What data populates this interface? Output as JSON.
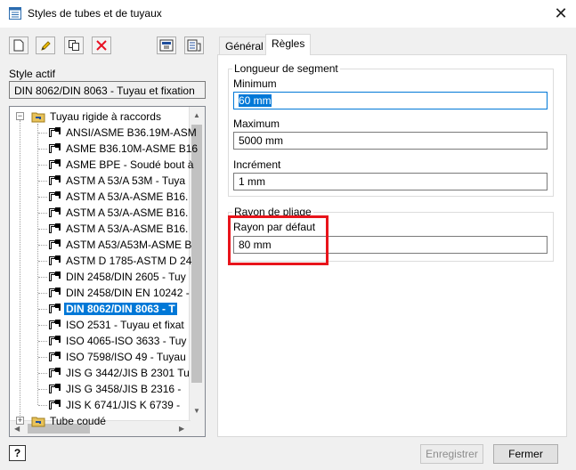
{
  "window": {
    "title": "Styles de tubes et de tuyaux",
    "close_glyph": "✕"
  },
  "toolbar": {
    "items": [
      {
        "name": "new-icon"
      },
      {
        "name": "edit-pencil-icon"
      },
      {
        "name": "copy-icon"
      },
      {
        "name": "delete-icon"
      },
      {
        "name": "import-icon"
      },
      {
        "name": "export-icon"
      }
    ]
  },
  "left": {
    "active_label": "Style actif",
    "active_value": "DIN 8062/DIN 8063 - Tuyau et fixation",
    "tree": {
      "root1": "Tuyau rigide à raccords",
      "items": [
        "ANSI/ASME B36.19M-ASM",
        "ASME B36.10M-ASME B16",
        "ASME BPE - Soudé bout à",
        "ASTM A 53/A 53M - Tuya",
        "ASTM A 53/A-ASME B16.",
        "ASTM A 53/A-ASME B16.",
        "ASTM A 53/A-ASME B16.",
        "ASTM A53/A53M-ASME B",
        "ASTM D 1785-ASTM D 24",
        "DIN 2458/DIN 2605 - Tuy",
        "DIN 2458/DIN EN 10242 -",
        "DIN 8062/DIN 8063 - T",
        "ISO 2531 - Tuyau et fixat",
        "ISO 4065-ISO 3633 - Tuy",
        "ISO 7598/ISO 49 - Tuyau",
        "JIS G 3442/JIS B 2301 Tu",
        "JIS G 3458/JIS B 2316 -",
        "JIS K 6741/JIS K 6739 -"
      ],
      "selected_index": 11,
      "root2": "Tube coudé"
    }
  },
  "tabs": [
    {
      "label": "Général"
    },
    {
      "label": "Règles"
    }
  ],
  "rules": {
    "segment_group": "Longueur de segment",
    "min_label": "Minimum",
    "min_value": "60 mm",
    "max_label": "Maximum",
    "max_value": "5000 mm",
    "inc_label": "Incrément",
    "inc_value": "1 mm",
    "bend_group": "Rayon de pliage",
    "radius_label": "Rayon par défaut",
    "radius_value": "80 mm"
  },
  "footer": {
    "help_glyph": "?",
    "save_label": "Enregistrer",
    "close_label": "Fermer"
  },
  "colors": {
    "selection": "#0078d7",
    "highlight_box": "#e8141b"
  }
}
